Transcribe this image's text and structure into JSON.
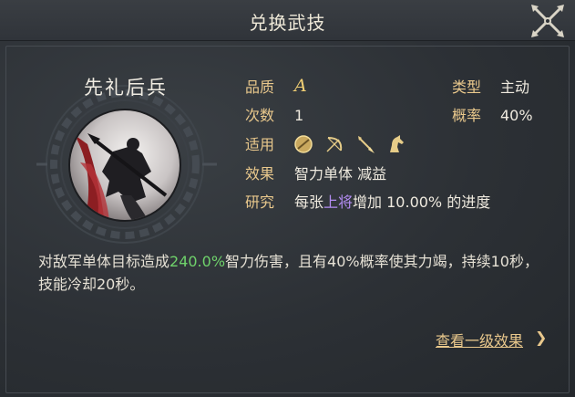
{
  "dialog": {
    "title": "兑换武技",
    "close_icon": "crossed-swords-close-icon"
  },
  "skill": {
    "name": "先礼后兵",
    "portrait_icon": "mounted-warrior-silhouette",
    "quality_label": "品质",
    "quality_value": "A",
    "type_label": "类型",
    "type_value": "主动",
    "count_label": "次数",
    "count_value": "1",
    "chance_label": "概率",
    "chance_value": "40%",
    "applicable_label": "适用",
    "applicable_icons": [
      "shield-unit-icon",
      "bow-unit-icon",
      "spear-unit-icon",
      "cavalry-unit-icon"
    ],
    "effect_label": "效果",
    "effect_value": "智力单体 减益",
    "research_label": "研究",
    "research_prefix": "每张",
    "research_highlight": "上将",
    "research_suffix": "增加 10.00% 的进度"
  },
  "description": {
    "part1": "对敌军单体目标造成",
    "damage_pct": "240.0%",
    "part2": "智力伤害，且有40%概率使其力竭，持续10秒，技能冷却20秒。"
  },
  "links": {
    "view_level1": "查看一级效果",
    "arrow": "❯"
  },
  "colors": {
    "label_gold": "#e9c88c",
    "grade_gold": "#f1cf74",
    "highlight_purple": "#b38cf2",
    "highlight_green": "#6fd26b"
  }
}
